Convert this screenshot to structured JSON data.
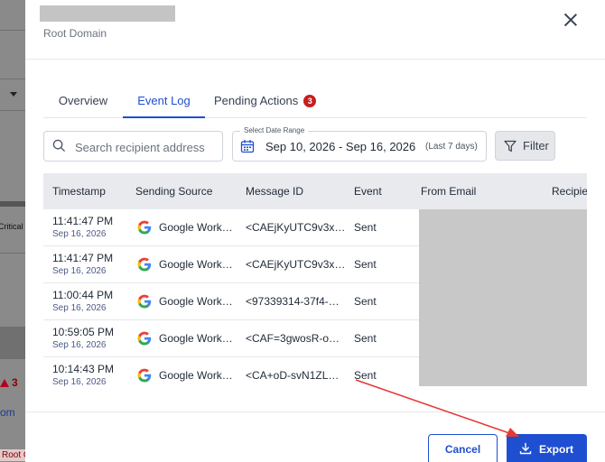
{
  "background": {
    "critical_text": "Critical",
    "alert_count": "3",
    "link_fragment": "om",
    "tag_fragment": "Root C"
  },
  "modal": {
    "subtitle": "Root Domain",
    "tabs": [
      {
        "label": "Overview"
      },
      {
        "label": "Event Log",
        "active": true
      },
      {
        "label": "Pending Actions",
        "badge": "3"
      }
    ],
    "search": {
      "placeholder": "Search recipient address",
      "value": ""
    },
    "date_range": {
      "legend": "Select Date Range",
      "value": "Sep 10, 2026 - Sep 16, 2026",
      "hint": "(Last 7 days)"
    },
    "filter_label": "Filter",
    "table": {
      "columns": [
        "Timestamp",
        "Sending Source",
        "Message ID",
        "Event",
        "From Email",
        "Recipie"
      ],
      "rows": [
        {
          "time": "11:41:47 PM",
          "date": "Sep 16, 2026",
          "source": "Google Work…",
          "message_id": "<CAEjKyUTC9v3x…",
          "event": "Sent"
        },
        {
          "time": "11:41:47 PM",
          "date": "Sep 16, 2026",
          "source": "Google Work…",
          "message_id": "<CAEjKyUTC9v3x…",
          "event": "Sent"
        },
        {
          "time": "11:00:44 PM",
          "date": "Sep 16, 2026",
          "source": "Google Work…",
          "message_id": "<97339314-37f4-…",
          "event": "Sent"
        },
        {
          "time": "10:59:05 PM",
          "date": "Sep 16, 2026",
          "source": "Google Work…",
          "message_id": "<CAF=3gwosR-o…",
          "event": "Sent"
        },
        {
          "time": "10:14:43 PM",
          "date": "Sep 16, 2026",
          "source": "Google Work…",
          "message_id": "<CA+oD-svN1ZL…",
          "event": "Sent"
        }
      ]
    },
    "footer": {
      "cancel_label": "Cancel",
      "export_label": "Export"
    }
  },
  "colors": {
    "accent": "#1f4fd1",
    "badge": "#c81e1e",
    "annotation_arrow": "#e53935"
  },
  "icons": [
    "close-icon",
    "search-icon",
    "calendar-icon",
    "filter-icon",
    "google-icon",
    "download-icon"
  ]
}
